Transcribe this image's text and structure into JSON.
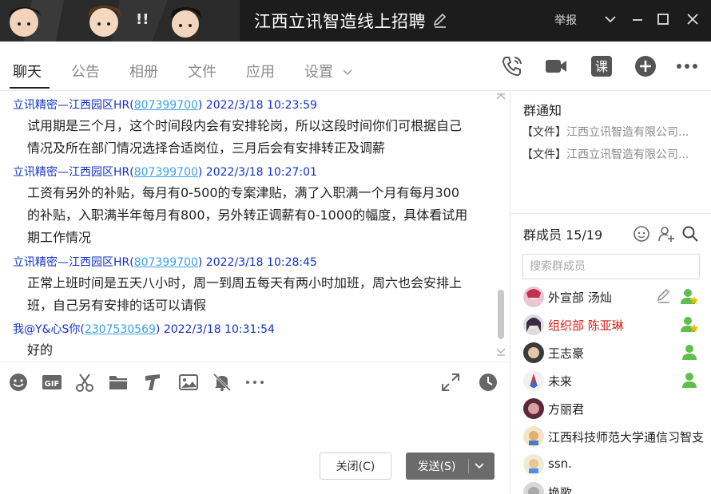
{
  "window": {
    "title": "江西立讯智造线上招聘",
    "report": "举报"
  },
  "tabs": [
    {
      "label": "聊天"
    },
    {
      "label": "公告"
    },
    {
      "label": "相册"
    },
    {
      "label": "文件"
    },
    {
      "label": "应用"
    },
    {
      "label": "设置"
    }
  ],
  "header_icons": [
    "phone-call-icon",
    "video-call-icon",
    "lesson-icon",
    "add-app-icon",
    "more-icon"
  ],
  "lesson_label": "课",
  "messages": [
    {
      "sender": "立讯精密—江西园区HR(",
      "qq": "807399700",
      "close": ")",
      "time": " 2022/3/18 10:23:59",
      "lines": [
        "试用期是三个月，这个时间段内会有安排轮岗，所以这段时间你们可根据自己",
        "情况及所在部门情况选择合适岗位，三月后会有安排转正及调薪"
      ]
    },
    {
      "sender": "立讯精密—江西园区HR(",
      "qq": "807399700",
      "close": ")",
      "time": " 2022/3/18 10:27:01",
      "lines": [
        "工资有另外的补贴，每月有0-500的专案津贴，满了入职满一个月有每月300",
        "的补贴，入职满半年每月有800，另外转正调薪有0-1000的幅度，具体看试用",
        "期工作情况"
      ]
    },
    {
      "sender": "立讯精密—江西园区HR(",
      "qq": "807399700",
      "close": ")",
      "time": " 2022/3/18 10:28:45",
      "lines": [
        "正常上班时间是五天八小时，周一到周五每天有两小时加班，周六也会安排上",
        "班，自己另有安排的话可以请假"
      ]
    },
    {
      "sender": "我@Y&心S你(",
      "qq": "2307530569",
      "close": ")",
      "time": " 2022/3/18 10:31:54",
      "lines": [
        "好的"
      ]
    }
  ],
  "toolbar_icons": [
    "emoji-icon",
    "gif-icon",
    "scissors-icon",
    "folder-icon",
    "music-icon",
    "image-icon",
    "mute-bell-icon",
    "more-tools-icon",
    "expand-icon",
    "history-clock-icon"
  ],
  "gif_label": "GIF",
  "buttons": {
    "close": "关闭(C)",
    "send": "发送(S)"
  },
  "right_panel": {
    "notice_title": "群通知",
    "notices": [
      {
        "prefix": "【文件】",
        "name": "江西立讯智造有限公司..."
      },
      {
        "prefix": "【文件】",
        "name": "江西立讯智造有限公司..."
      }
    ],
    "members_title": "群成员 15/19",
    "search_placeholder": "搜索群成员",
    "members": [
      {
        "name": "外宣部 汤灿",
        "highlight": false,
        "role": "owner"
      },
      {
        "name": "组织部 陈亚琳",
        "highlight": true,
        "role": "owner"
      },
      {
        "name": "王志豪",
        "highlight": false,
        "role": "admin"
      },
      {
        "name": "未来",
        "highlight": false,
        "role": "admin"
      },
      {
        "name": "方丽君",
        "highlight": false,
        "role": "none"
      },
      {
        "name": "江西科技师范大学通信习智支",
        "highlight": false,
        "role": "none"
      },
      {
        "name": "ssn.",
        "highlight": false,
        "role": "none"
      },
      {
        "name": "换歌",
        "highlight": false,
        "role": "none"
      }
    ]
  },
  "colors": {
    "sender": "#1232c8",
    "qq_link": "#3aa0e8",
    "highlight_member": "#d8201c",
    "titlebar": "#1c1c1c",
    "send_button": "#6b6b6b"
  }
}
